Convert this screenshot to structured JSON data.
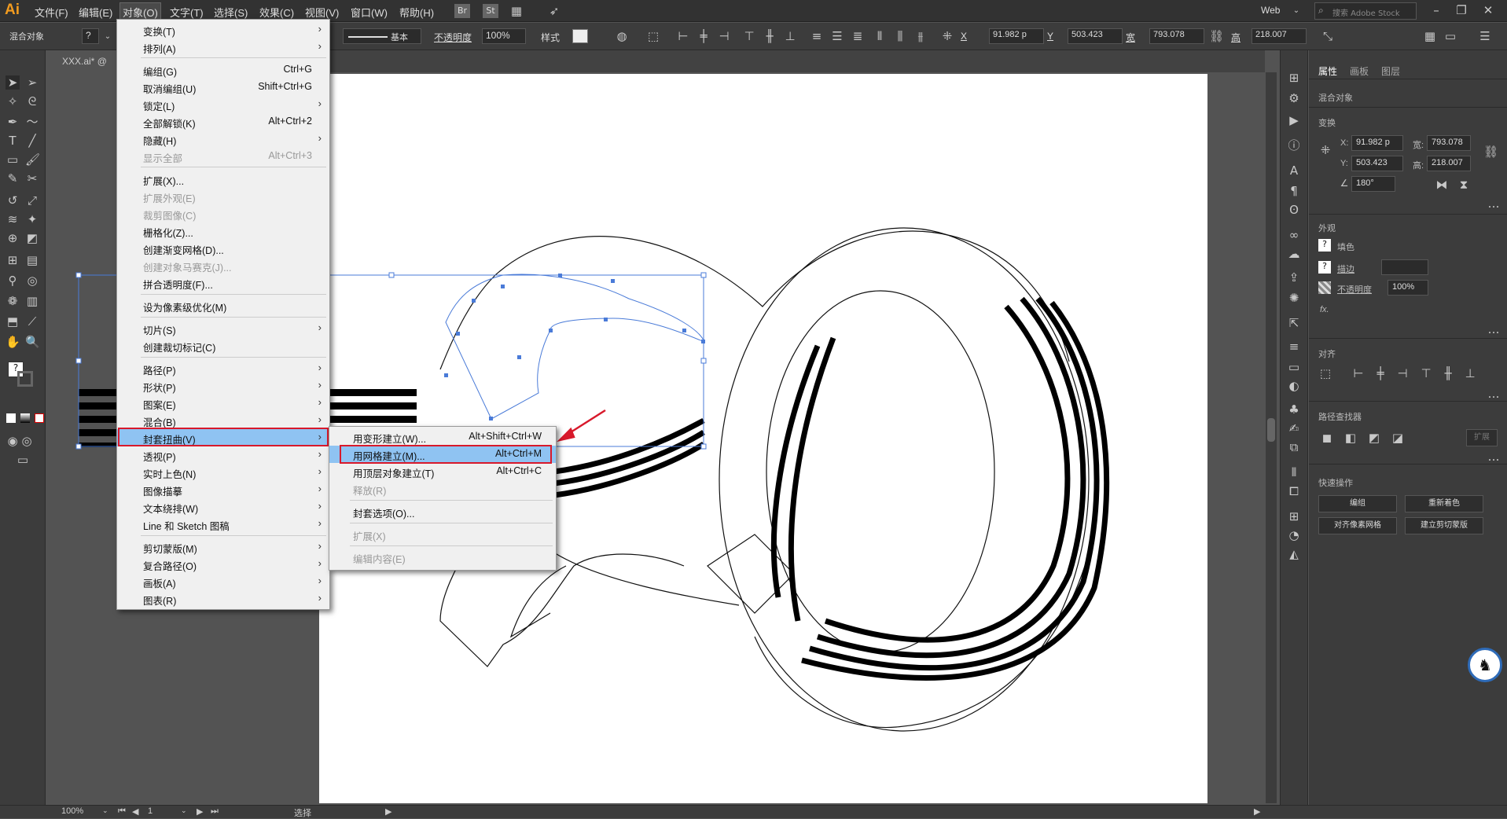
{
  "app": {
    "logo": "Ai",
    "workspace": "Web",
    "search_placeholder": "搜索 Adobe Stock"
  },
  "menubar": {
    "items": [
      "文件(F)",
      "编辑(E)",
      "对象(O)",
      "文字(T)",
      "选择(S)",
      "效果(C)",
      "视图(V)",
      "窗口(W)",
      "帮助(H)"
    ],
    "br": "Br",
    "st": "St"
  },
  "control": {
    "selection_label": "混合对象",
    "stroke_style": "基本",
    "opacity_label": "不透明度",
    "opacity": "100%",
    "style_label": "样式",
    "x_label": "X",
    "x": "91.982 p",
    "y_label": "Y",
    "y": "503.423",
    "w_label": "宽",
    "w": "793.078",
    "h_label": "高",
    "h": "218.007"
  },
  "document": {
    "tab": "XXX.ai* @"
  },
  "object_menu": {
    "items": [
      {
        "label": "变换(T)",
        "shortcut": "",
        "submenu": true,
        "disabled": false
      },
      {
        "label": "排列(A)",
        "shortcut": "",
        "submenu": true,
        "disabled": false
      },
      {
        "label": "编组(G)",
        "shortcut": "Ctrl+G",
        "submenu": false,
        "disabled": false
      },
      {
        "label": "取消编组(U)",
        "shortcut": "Shift+Ctrl+G",
        "submenu": false,
        "disabled": false
      },
      {
        "label": "锁定(L)",
        "shortcut": "",
        "submenu": true,
        "disabled": false
      },
      {
        "label": "全部解锁(K)",
        "shortcut": "Alt+Ctrl+2",
        "submenu": false,
        "disabled": false
      },
      {
        "label": "隐藏(H)",
        "shortcut": "",
        "submenu": true,
        "disabled": false
      },
      {
        "label": "显示全部",
        "shortcut": "Alt+Ctrl+3",
        "submenu": false,
        "disabled": true
      },
      {
        "label": "扩展(X)...",
        "shortcut": "",
        "submenu": false,
        "disabled": false
      },
      {
        "label": "扩展外观(E)",
        "shortcut": "",
        "submenu": false,
        "disabled": true
      },
      {
        "label": "裁剪图像(C)",
        "shortcut": "",
        "submenu": false,
        "disabled": true
      },
      {
        "label": "栅格化(Z)...",
        "shortcut": "",
        "submenu": false,
        "disabled": false
      },
      {
        "label": "创建渐变网格(D)...",
        "shortcut": "",
        "submenu": false,
        "disabled": false
      },
      {
        "label": "创建对象马赛克(J)...",
        "shortcut": "",
        "submenu": false,
        "disabled": true
      },
      {
        "label": "拼合透明度(F)...",
        "shortcut": "",
        "submenu": false,
        "disabled": false
      },
      {
        "label": "设为像素级优化(M)",
        "shortcut": "",
        "submenu": false,
        "disabled": false
      },
      {
        "label": "切片(S)",
        "shortcut": "",
        "submenu": true,
        "disabled": false
      },
      {
        "label": "创建裁切标记(C)",
        "shortcut": "",
        "submenu": false,
        "disabled": false
      },
      {
        "label": "路径(P)",
        "shortcut": "",
        "submenu": true,
        "disabled": false
      },
      {
        "label": "形状(P)",
        "shortcut": "",
        "submenu": true,
        "disabled": false
      },
      {
        "label": "图案(E)",
        "shortcut": "",
        "submenu": true,
        "disabled": false
      },
      {
        "label": "混合(B)",
        "shortcut": "",
        "submenu": true,
        "disabled": false
      },
      {
        "label": "封套扭曲(V)",
        "shortcut": "",
        "submenu": true,
        "disabled": false
      },
      {
        "label": "透视(P)",
        "shortcut": "",
        "submenu": true,
        "disabled": false
      },
      {
        "label": "实时上色(N)",
        "shortcut": "",
        "submenu": true,
        "disabled": false
      },
      {
        "label": "图像描摹",
        "shortcut": "",
        "submenu": true,
        "disabled": false
      },
      {
        "label": "文本绕排(W)",
        "shortcut": "",
        "submenu": true,
        "disabled": false
      },
      {
        "label": "Line 和 Sketch 图稿",
        "shortcut": "",
        "submenu": true,
        "disabled": false
      },
      {
        "label": "剪切蒙版(M)",
        "shortcut": "",
        "submenu": true,
        "disabled": false
      },
      {
        "label": "复合路径(O)",
        "shortcut": "",
        "submenu": true,
        "disabled": false
      },
      {
        "label": "画板(A)",
        "shortcut": "",
        "submenu": true,
        "disabled": false
      },
      {
        "label": "图表(R)",
        "shortcut": "",
        "submenu": true,
        "disabled": false
      }
    ]
  },
  "envelope_menu": {
    "items": [
      {
        "label": "用变形建立(W)...",
        "shortcut": "Alt+Shift+Ctrl+W",
        "disabled": false
      },
      {
        "label": "用网格建立(M)...",
        "shortcut": "Alt+Ctrl+M",
        "disabled": false
      },
      {
        "label": "用顶层对象建立(T)",
        "shortcut": "Alt+Ctrl+C",
        "disabled": false
      },
      {
        "label": "释放(R)",
        "shortcut": "",
        "disabled": true
      },
      {
        "label": "封套选项(O)...",
        "shortcut": "",
        "disabled": false
      },
      {
        "label": "扩展(X)",
        "shortcut": "",
        "disabled": true
      },
      {
        "label": "编辑内容(E)",
        "shortcut": "",
        "disabled": true
      }
    ]
  },
  "properties": {
    "tabs": [
      "属性",
      "画板",
      "图层"
    ],
    "object_type": "混合对象",
    "transform_title": "变换",
    "x_label": "X:",
    "x": "91.982 p",
    "y_label": "Y:",
    "y": "503.423",
    "w_label": "宽:",
    "w": "793.078",
    "h_label": "高:",
    "h": "218.007",
    "angle": "180°",
    "appearance_title": "外观",
    "fill_label": "填色",
    "stroke_label": "描边",
    "opacity_label": "不透明度",
    "opacity": "100%",
    "fx": "fx.",
    "align_title": "对齐",
    "pathfinder_title": "路径查找器",
    "expand": "扩展",
    "quick_title": "快速操作",
    "buttons": [
      "编组",
      "重新着色",
      "对齐像素网格",
      "建立剪切蒙版"
    ]
  },
  "status": {
    "zoom": "100%",
    "page": "1",
    "tool": "选择"
  },
  "colors": {
    "highlight": "#8fc3f2",
    "red": "#d8192b",
    "selection": "#4a7bd8"
  }
}
